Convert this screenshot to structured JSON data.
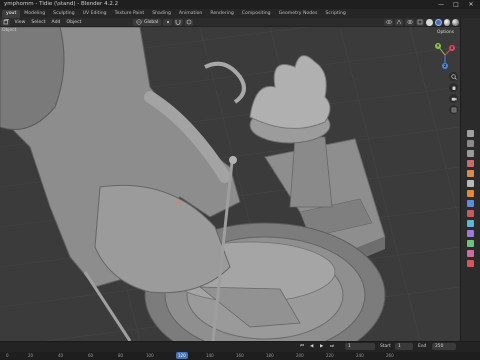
{
  "window": {
    "title": "ymphomm - Tidie (\\stand) - Blender 4.2.2",
    "controls": [
      "—",
      "□",
      "✕"
    ]
  },
  "workspace_tabs": [
    "yout",
    "Modeling",
    "Sculpting",
    "UV Editing",
    "Texture Paint",
    "Shading",
    "Animation",
    "Rendering",
    "Compositing",
    "Geometry Nodes",
    "Scripting"
  ],
  "active_tab_index": 0,
  "viewport_header": {
    "menus": [
      "View",
      "Select",
      "Add",
      "Object"
    ],
    "orientation": "Global",
    "object_mode_label": "Object"
  },
  "viewport": {
    "options_label": "Options",
    "gizmo_axes": [
      "Y",
      "X",
      "Z"
    ]
  },
  "timeline": {
    "ticks": [
      "20",
      "40",
      "60",
      "80",
      "100",
      "120",
      "140",
      "160",
      "180",
      "200",
      "220",
      "240",
      "260"
    ],
    "current_frame": "120",
    "frame_field": "1",
    "start_label": "Start",
    "start_value": "1",
    "end_label": "End",
    "end_value": "250",
    "playback": [
      "⏮",
      "◀",
      "▶",
      "⏭"
    ],
    "partial_left_ticks": [
      "0",
      "20"
    ]
  },
  "colors": {
    "accent": "#4772b3",
    "x_axis": "#e24a5a",
    "y_axis": "#8ac34b",
    "z_axis": "#4a86e2"
  }
}
